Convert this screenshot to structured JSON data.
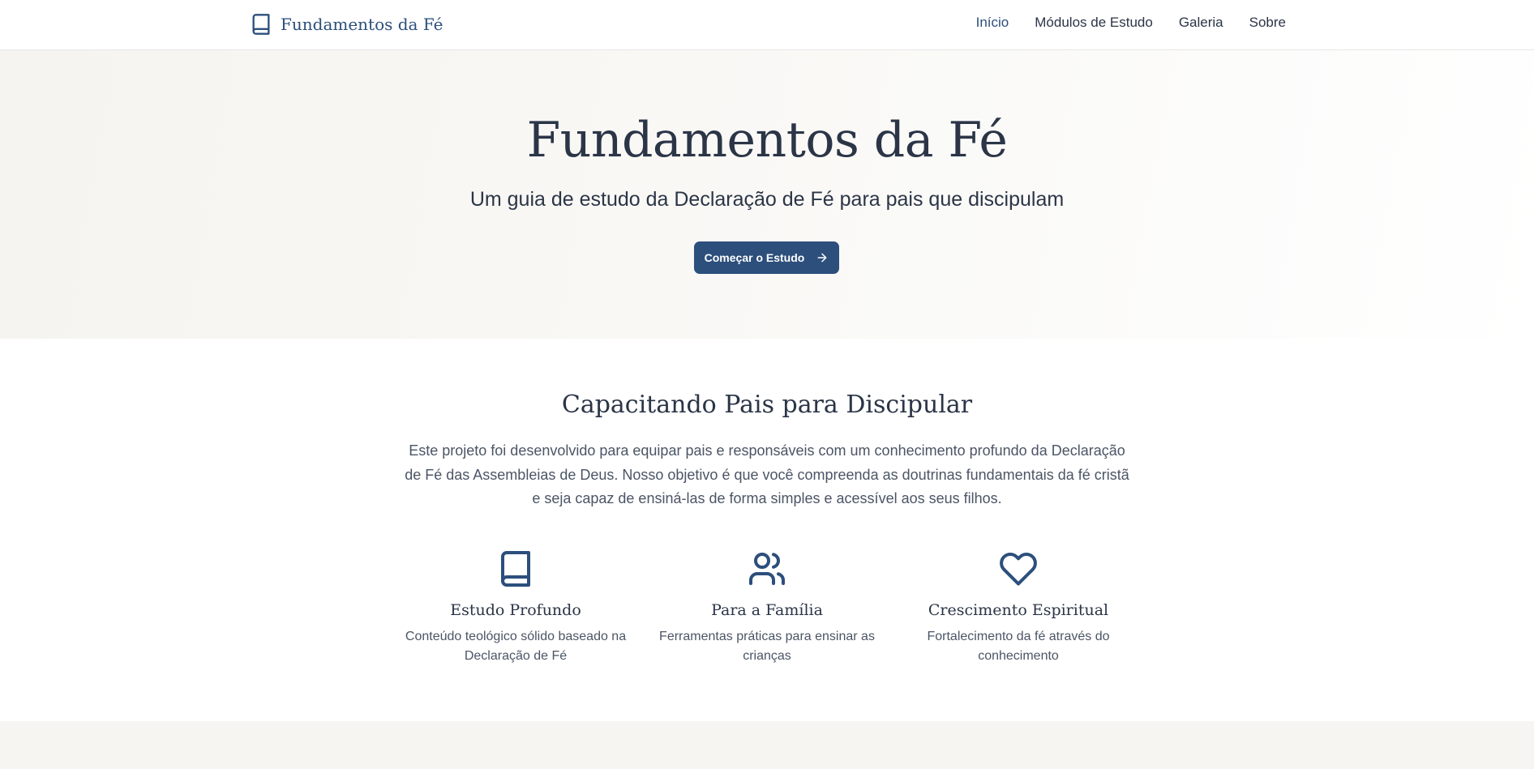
{
  "header": {
    "brand": {
      "name": "Fundamentos da Fé",
      "icon": "book-open-icon",
      "color": "#2c4f7c"
    },
    "nav": [
      {
        "label": "Início",
        "active": true
      },
      {
        "label": "Módulos de Estudo",
        "active": false
      },
      {
        "label": "Galeria",
        "active": false
      },
      {
        "label": "Sobre",
        "active": false
      }
    ]
  },
  "hero": {
    "title": "Fundamentos da Fé",
    "subtitle": "Um guia de estudo da Declaração de Fé para pais que discipulam",
    "cta": {
      "label": "Começar o Estudo",
      "icon": "arrow-right-icon",
      "color": "#2c4f7c"
    }
  },
  "about": {
    "title": "Capacitando Pais para Discipular",
    "description": "Este projeto foi desenvolvido para equipar pais e responsáveis com um conhecimento profundo da Declaração de Fé das Assembleias de Deus. Nosso objetivo é que você compreenda as doutrinas fundamentais da fé cristã e seja capaz de ensiná-las de forma simples e acessível aos seus filhos.",
    "features": [
      {
        "icon": "book-icon",
        "title": "Estudo Profundo",
        "description": "Conteúdo teológico sólido baseado na Declaração de Fé"
      },
      {
        "icon": "users-icon",
        "title": "Para a Família",
        "description": "Ferramentas práticas para ensinar as crianças"
      },
      {
        "icon": "heart-icon",
        "title": "Crescimento Espiritual",
        "description": "Fortalecimento da fé através do conhecimento"
      }
    ]
  },
  "colors": {
    "primary": "#2c4f7c",
    "text": "#2b3547",
    "muted_text": "#4b5565",
    "hero_background": "#f7f5f1",
    "section_band": "#f6f5f1"
  }
}
